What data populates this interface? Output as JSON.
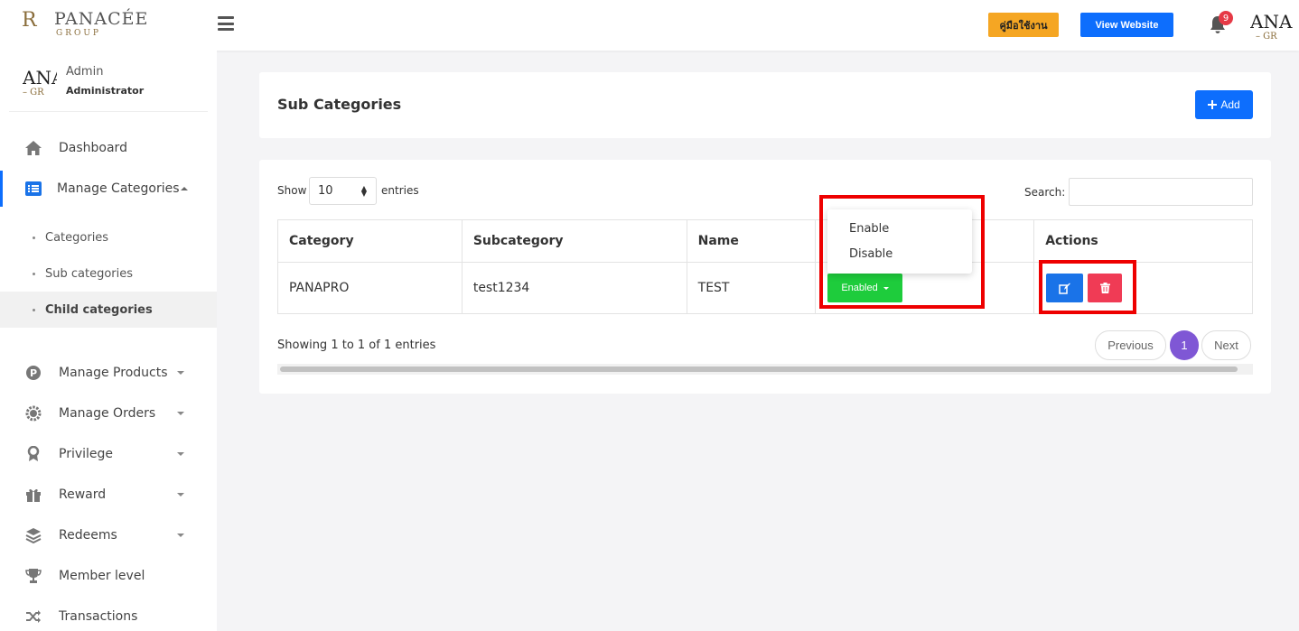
{
  "header": {
    "logo_brand": "PANACÉE",
    "logo_sub": "GROUP",
    "logo_mono": "R",
    "manual_button": "คู่มือใช้งาน",
    "website_button": "View Website",
    "notification_count": "9",
    "avatar_text": "ANA",
    "avatar_sub": "– GR"
  },
  "sidebar": {
    "user_name": "Admin",
    "user_role": "Administrator",
    "avatar_text": "ANA",
    "avatar_sub": "– GR",
    "items": [
      {
        "label": "Dashboard",
        "icon": "home-icon"
      },
      {
        "label": "Manage Categories",
        "icon": "list-icon"
      },
      {
        "label": "Manage Products",
        "icon": "p-circle-icon"
      },
      {
        "label": "Manage Orders",
        "icon": "gear-badge-icon"
      },
      {
        "label": "Privilege",
        "icon": "award-icon"
      },
      {
        "label": "Reward",
        "icon": "gift-icon"
      },
      {
        "label": "Redeems",
        "icon": "layers-icon"
      },
      {
        "label": "Member level",
        "icon": "trophy-icon"
      },
      {
        "label": "Transactions",
        "icon": "shuffle-icon"
      }
    ],
    "sub_items": [
      "Categories",
      "Sub categories",
      "Child categories"
    ]
  },
  "page": {
    "title": "Sub Categories",
    "add_button": "Add"
  },
  "table": {
    "show_label": "Show",
    "entries_value": "10",
    "entries_label": "entries",
    "search_label": "Search:",
    "columns": [
      "Category",
      "Subcategory",
      "Name",
      "",
      "Actions"
    ],
    "rows": [
      {
        "category": "PANAPRO",
        "subcategory": "test1234",
        "name": "TEST",
        "status": "Enabled"
      }
    ],
    "status_options": [
      "Enable",
      "Disable"
    ],
    "info": "Showing 1 to 1 of 1 entries",
    "pagination": {
      "previous": "Previous",
      "current": "1",
      "next": "Next"
    }
  },
  "colors": {
    "primary": "#0d6efd",
    "warning": "#f5a623",
    "success": "#1ecc3c",
    "danger": "#f03b55",
    "highlight": "#ee0000",
    "pagination_active": "#7f57d5"
  }
}
